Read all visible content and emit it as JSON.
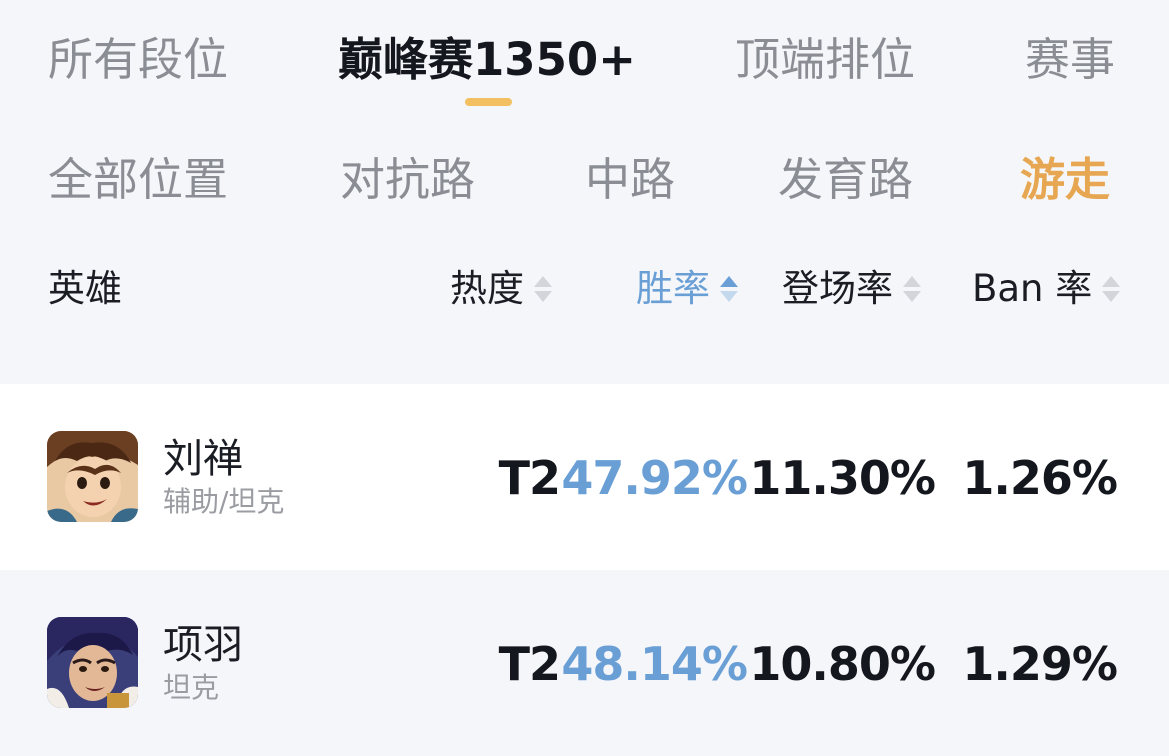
{
  "rank_tabs": [
    {
      "label": "所有段位",
      "active": false
    },
    {
      "label": "巅峰赛1350+",
      "active": true
    },
    {
      "label": "顶端排位",
      "active": false
    },
    {
      "label": "赛事",
      "active": false
    }
  ],
  "position_tabs": [
    {
      "label": "全部位置",
      "active": false
    },
    {
      "label": "对抗路",
      "active": false
    },
    {
      "label": "中路",
      "active": false
    },
    {
      "label": "发育路",
      "active": false
    },
    {
      "label": "游走",
      "active": true
    }
  ],
  "columns": {
    "hero": "英雄",
    "heat": "热度",
    "win_rate": "胜率",
    "pick_rate": "登场率",
    "ban_rate": "Ban 率",
    "sorted_by": "win_rate",
    "sort_direction": "asc"
  },
  "heroes": [
    {
      "name": "刘禅",
      "role": "辅助/坦克",
      "tier": "T2",
      "win_rate": "47.92%",
      "pick_rate": "11.30%",
      "ban_rate": "1.26%",
      "avatar_icon": "liu-shan-portrait"
    },
    {
      "name": "项羽",
      "role": "坦克",
      "tier": "T2",
      "win_rate": "48.14%",
      "pick_rate": "10.80%",
      "ban_rate": "1.29%",
      "avatar_icon": "xiang-yu-portrait"
    }
  ],
  "colors": {
    "accent_orange": "#e7a752",
    "accent_blue": "#6a9fd6",
    "indicator": "#f2c060",
    "inactive_text": "#8a8d93"
  }
}
